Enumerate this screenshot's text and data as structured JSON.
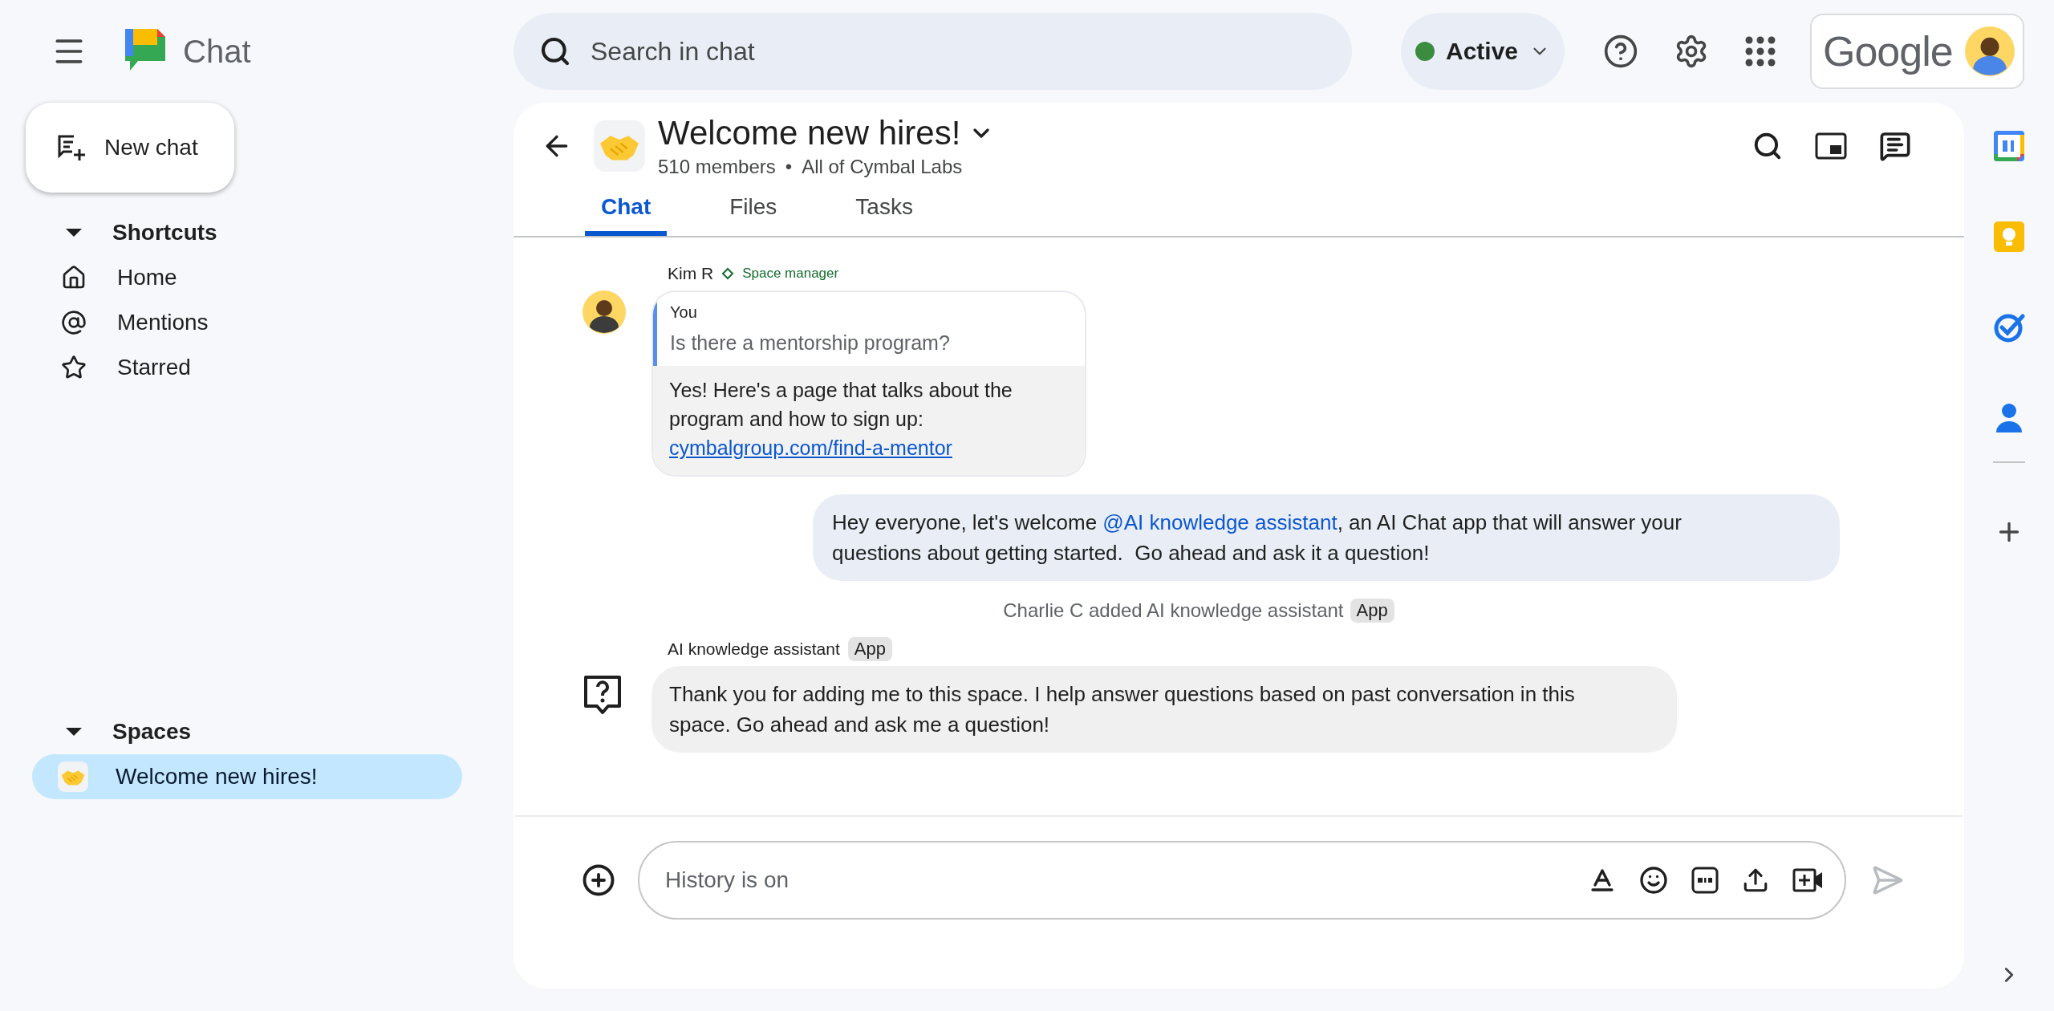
{
  "app": {
    "name": "Chat"
  },
  "search": {
    "placeholder": "Search in chat"
  },
  "status": {
    "label": "Active"
  },
  "account": {
    "label": "Google"
  },
  "new_chat": {
    "label": "New chat"
  },
  "shortcuts": {
    "title": "Shortcuts",
    "expanded": true,
    "items": [
      {
        "kind": "home",
        "label": "Home"
      },
      {
        "kind": "mentions",
        "label": "Mentions"
      },
      {
        "kind": "starred",
        "label": "Starred"
      }
    ]
  },
  "spaces": {
    "title": "Spaces",
    "expanded": true,
    "items": [
      {
        "label": "Welcome new hires!",
        "selected": true
      }
    ]
  },
  "space": {
    "title": "Welcome new hires!",
    "members": "510 members",
    "separator": "•",
    "org": "All of Cymbal Labs"
  },
  "tabs": [
    {
      "label": "Chat",
      "selected": true
    },
    {
      "label": "Files",
      "selected": false
    },
    {
      "label": "Tasks",
      "selected": false
    }
  ],
  "messages": [
    {
      "kind": "reply",
      "sender": "Kim R",
      "role": "Space manager",
      "quote_author": "You",
      "quote": "Is there a mentorship program?",
      "text": "Yes! Here's a page that talks about the program and how to sign up:",
      "link": "cymbalgroup.com/find-a-mentor"
    },
    {
      "kind": "own",
      "text_before": "Hey everyone, let's welcome ",
      "mention": "@AI knowledge assistant",
      "text_after": ", an AI Chat app that will answer your questions about getting started.  Go ahead and ask it a question!"
    },
    {
      "kind": "system",
      "text": "Charlie C added AI knowledge assistant",
      "badge": "App"
    },
    {
      "kind": "app",
      "sender": "AI knowledge assistant",
      "badge": "App",
      "text": "Thank you for adding me to this space. I help answer questions based on past conversation in this space. Go ahead and ask me a question!"
    }
  ],
  "composer": {
    "placeholder": "History is on"
  }
}
